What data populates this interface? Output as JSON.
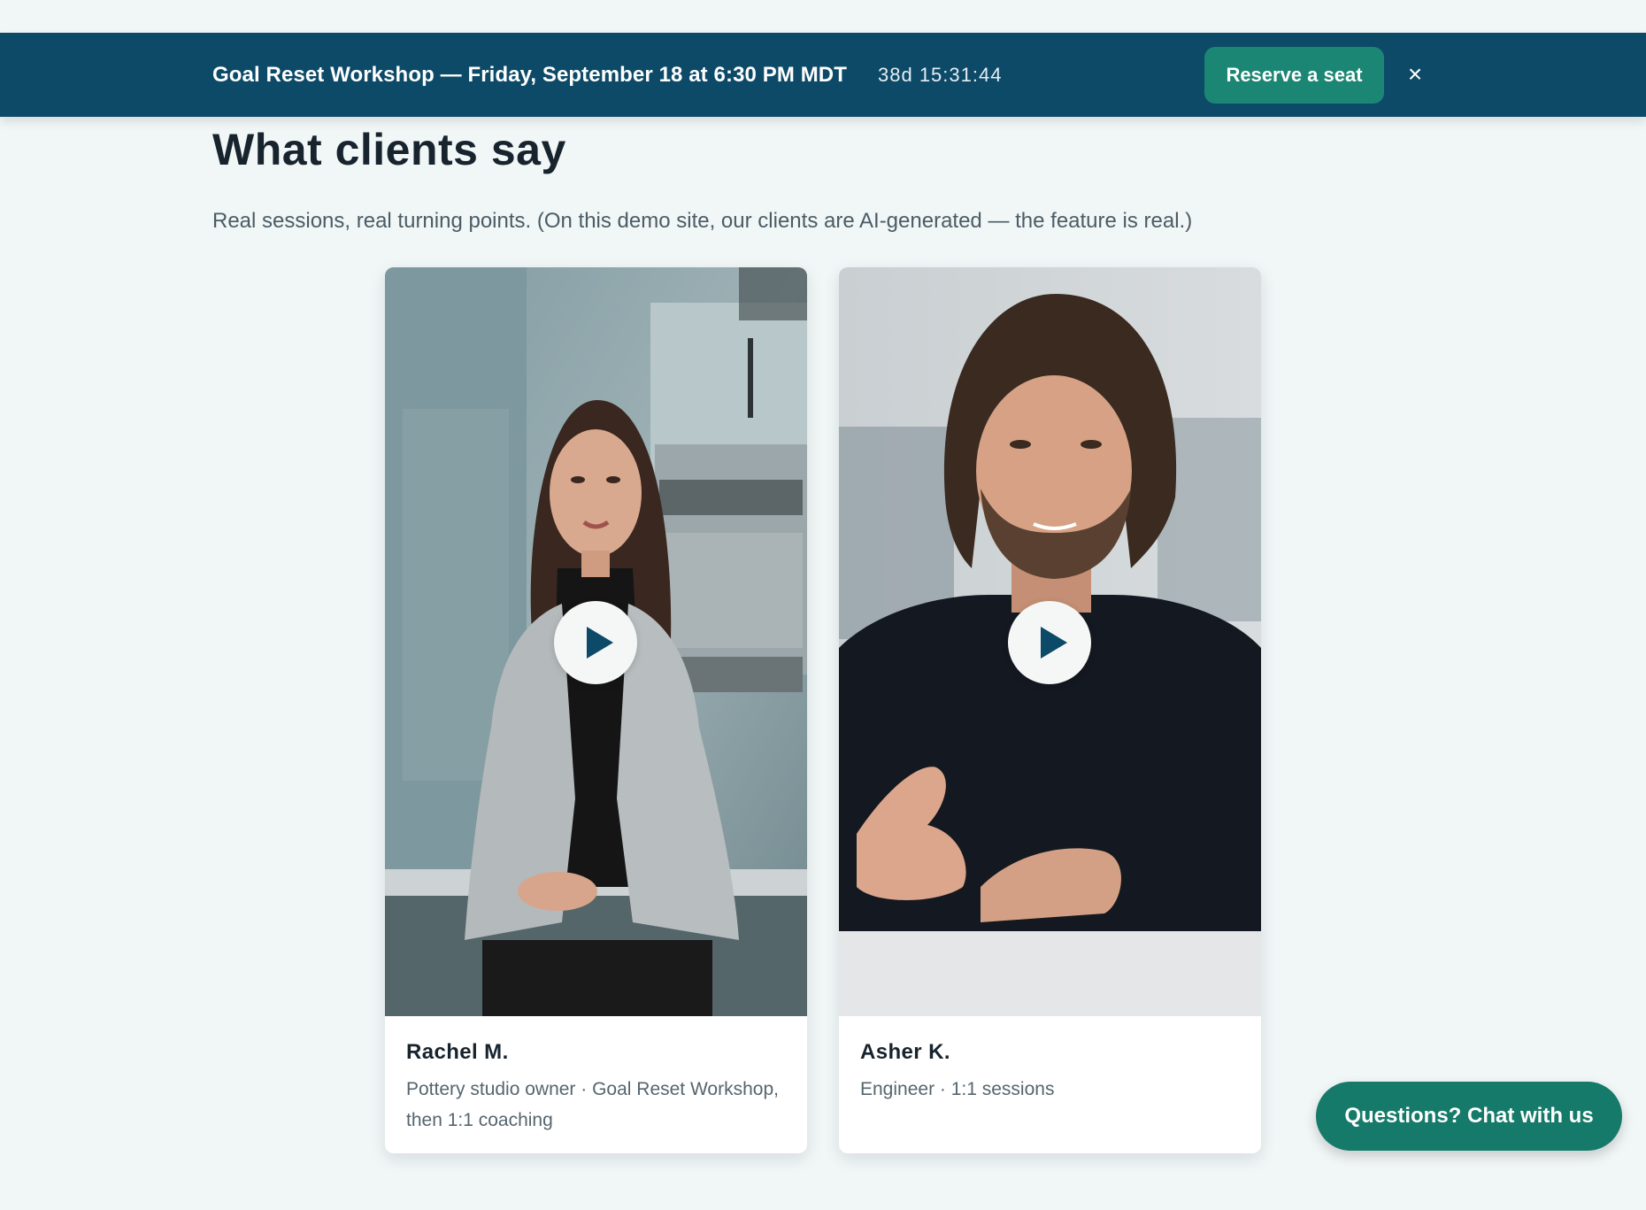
{
  "promo_bar": {
    "title": "Goal Reset Workshop — Friday, September 18 at 6:30 PM MDT",
    "countdown": "38d 15:31:44",
    "cta_label": "Reserve a seat",
    "close_glyph": "×"
  },
  "section": {
    "title": "What clients say",
    "subtitle": "Real sessions, real turning points. (On this demo site, our clients are AI-generated — the feature is real.)"
  },
  "testimonials": [
    {
      "name": "Rachel M.",
      "meta": "Pottery studio owner · Goal Reset Workshop, then 1:1 coaching",
      "media_icon": "play-icon"
    },
    {
      "name": "Asher K.",
      "meta": "Engineer · 1:1 sessions",
      "media_icon": "play-icon"
    }
  ],
  "chat_button": {
    "label": "Questions? Chat with us"
  },
  "colors": {
    "page_bg": "#f1f6f6",
    "promo_bg": "#0d4a68",
    "accent_green": "#1b8673",
    "heading": "#17242e",
    "muted_text": "#4b5c66"
  }
}
